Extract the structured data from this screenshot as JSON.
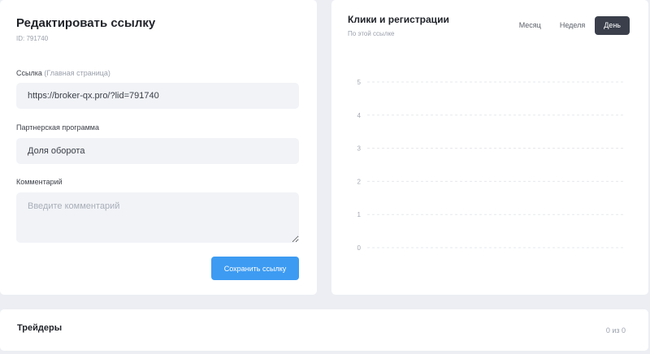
{
  "edit": {
    "title": "Редактировать ссылку",
    "id_label": "ID: 791740",
    "link_label": "Ссылка",
    "link_hint": "(Главная страница)",
    "link_value": "https://broker-qx.pro/?lid=791740",
    "program_label": "Партнерская программа",
    "program_value": "Доля оборота",
    "comment_label": "Комментарий",
    "comment_placeholder": "Введите комментарий",
    "save_label": "Сохранить ссылку"
  },
  "chart": {
    "title": "Клики и регистрации",
    "subtitle": "По этой ссылке",
    "tabs": [
      {
        "label": "Месяц",
        "active": false
      },
      {
        "label": "Неделя",
        "active": false
      },
      {
        "label": "День",
        "active": true
      }
    ]
  },
  "chart_data": {
    "type": "line",
    "title": "Клики и регистрации",
    "subtitle": "По этой ссылке",
    "xlabel": "",
    "ylabel": "",
    "y_ticks": [
      5,
      4,
      3,
      2,
      1,
      0
    ],
    "ylim": [
      0,
      5
    ],
    "grid": true,
    "series": []
  },
  "traders": {
    "title": "Трейдеры",
    "count": "0 из 0"
  },
  "colors": {
    "accent": "#3d9bf2",
    "active_tab": "#3a3f4b",
    "background": "#eceef3"
  }
}
